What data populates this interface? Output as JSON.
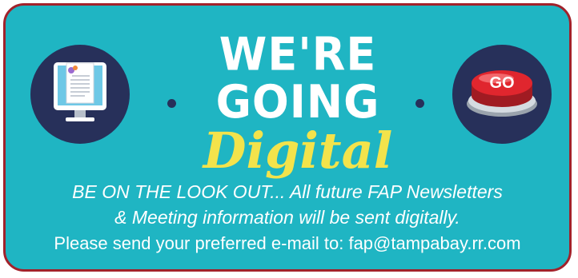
{
  "banner": {
    "title_line1": "WE'RE GOING",
    "title_line2": "Digital",
    "go_button_label": "GO",
    "notice_line1": "BE ON THE LOOK OUT... All future FAP Newsletters",
    "notice_line2": "& Meeting information will be sent digitally.",
    "notice_line3": "Please send your preferred e-mail to: fap@tampabay.rr.com"
  },
  "icons": {
    "left": "computer-monitor-document-icon",
    "right": "red-go-button-icon"
  },
  "colors": {
    "background": "#1fb5c3",
    "border": "#a2222b",
    "circle": "#27305a",
    "digital_text": "#f3e34b",
    "go_button": "#d9252b"
  }
}
